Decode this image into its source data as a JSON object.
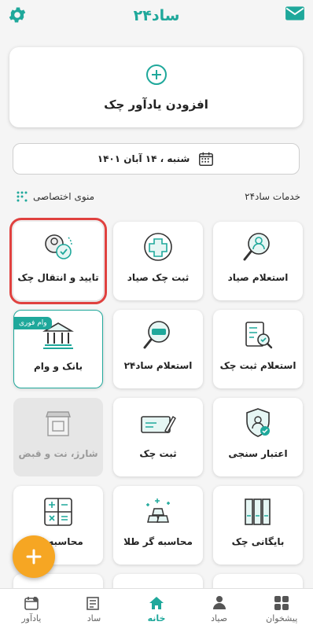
{
  "app": {
    "title": "ساد۲۴"
  },
  "icons": {
    "settings": "gear-icon",
    "messages": "mail-icon"
  },
  "colors": {
    "accent": "#1fa89b",
    "fab": "#f6a623",
    "highlight": "#e0413f"
  },
  "add_reminder": {
    "label": "افزودن یادآور چک"
  },
  "date": {
    "text": "شنبه ، ۱۴ آبان ۱۴۰۱"
  },
  "services": {
    "title": "خدمات ساد۲۴",
    "custom_menu": "منوی اختصاصی"
  },
  "tiles": [
    {
      "label": "استعلام صیاد",
      "icon": "person-search-icon"
    },
    {
      "label": "ثبت چک صیاد",
      "icon": "cheque-register-icon"
    },
    {
      "label": "تایید و انتقال چک",
      "icon": "cheque-confirm-transfer-icon"
    },
    {
      "label": "استعلام ثبت چک",
      "icon": "document-search-icon"
    },
    {
      "label": "استعلام ساد۲۴",
      "icon": "sad24-search-icon"
    },
    {
      "label": "بانک و وام",
      "icon": "bank-icon",
      "badge": "وام فوری"
    },
    {
      "label": "اعتبار سنجی",
      "icon": "credit-shield-icon"
    },
    {
      "label": "ثبت چک",
      "icon": "cheque-pen-icon"
    },
    {
      "label": "شارژ، نت و قبض",
      "icon": "store-icon"
    },
    {
      "label": "بایگانی چک",
      "icon": "archive-binders-icon"
    },
    {
      "label": "محاسبه گر طلا",
      "icon": "gold-bars-icon"
    },
    {
      "label": "محاسبه اق",
      "icon": "calculator-icon"
    }
  ],
  "bottom_nav": [
    {
      "label": "پیشخوان",
      "icon": "grid-icon"
    },
    {
      "label": "صیاد",
      "icon": "users-icon"
    },
    {
      "label": "خانه",
      "icon": "home-icon",
      "active": true
    },
    {
      "label": "ساد",
      "icon": "cheque-book-icon"
    },
    {
      "label": "یادآور",
      "icon": "calendar-reminder-icon"
    }
  ]
}
